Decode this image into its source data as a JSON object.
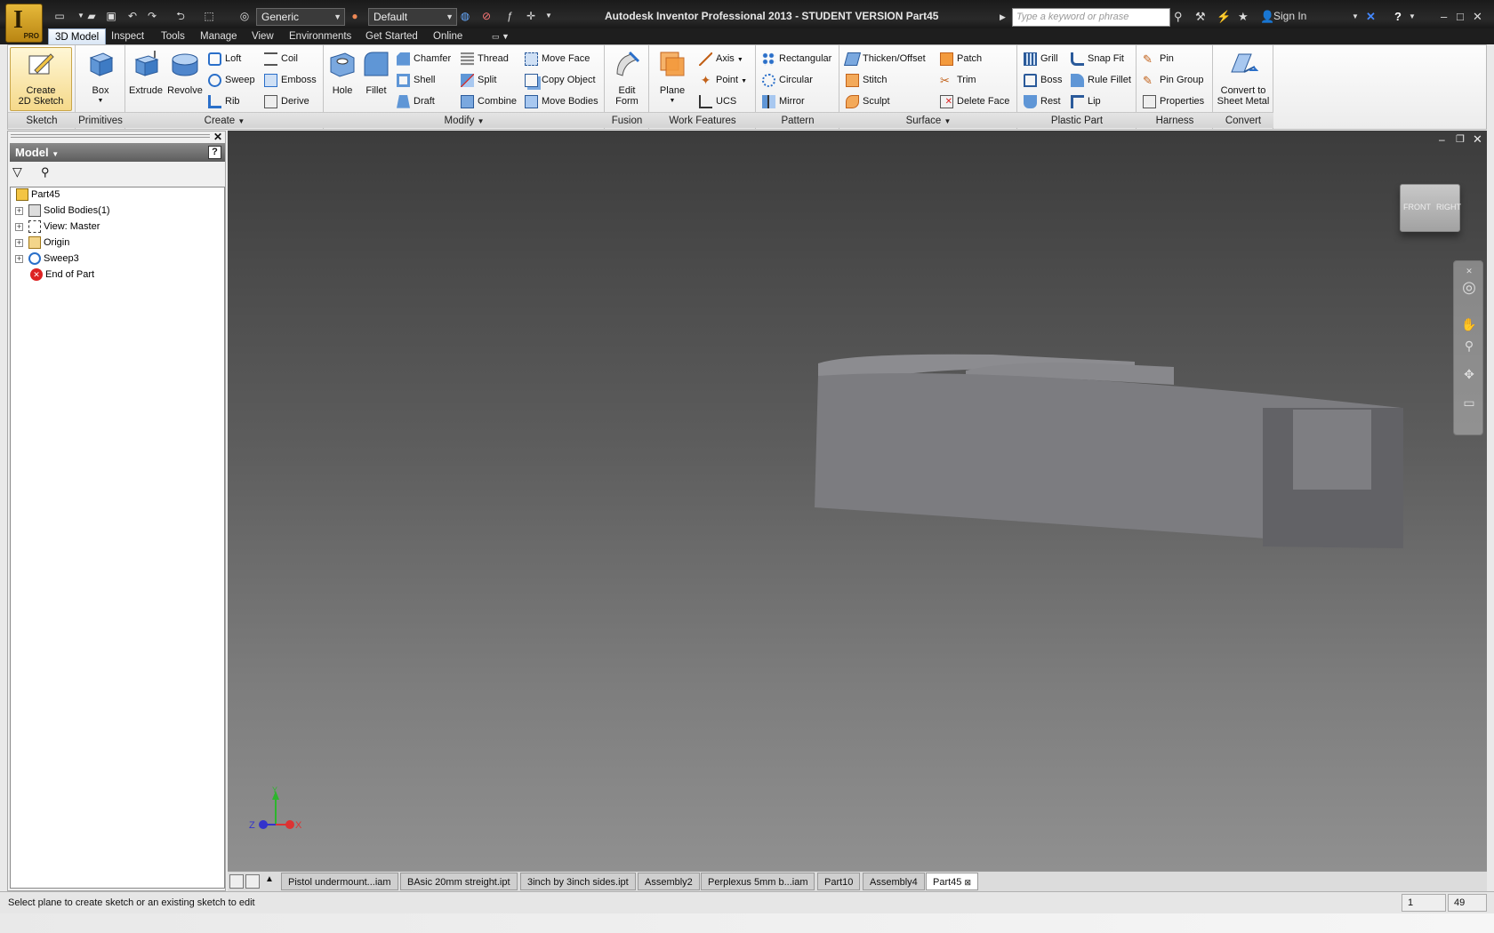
{
  "window": {
    "title": "Autodesk Inventor Professional 2013 - STUDENT VERSION   Part45",
    "logo_letter": "I",
    "logo_badge": "PRO"
  },
  "quick_access": {
    "material": "Generic",
    "appearance": "Default",
    "search_placeholder": "Type a keyword or phrase",
    "sign_in": "Sign In"
  },
  "menu_tabs": [
    "3D Model",
    "Inspect",
    "Tools",
    "Manage",
    "View",
    "Environments",
    "Get Started",
    "Online"
  ],
  "ribbon": {
    "sketch": {
      "title": "Sketch",
      "create_2d_sketch": [
        "Create",
        "2D Sketch"
      ]
    },
    "primitives": {
      "title": "Primitives",
      "box": "Box"
    },
    "create": {
      "title": "Create",
      "extrude": "Extrude",
      "revolve": "Revolve",
      "loft": "Loft",
      "sweep": "Sweep",
      "rib": "Rib",
      "coil": "Coil",
      "emboss": "Emboss",
      "derive": "Derive"
    },
    "modify": {
      "title": "Modify",
      "hole": "Hole",
      "fillet": "Fillet",
      "chamfer": "Chamfer",
      "shell": "Shell",
      "draft": "Draft",
      "thread": "Thread",
      "split": "Split",
      "combine": "Combine",
      "move_face": "Move Face",
      "copy_object": "Copy Object",
      "move_bodies": "Move Bodies"
    },
    "fusion": {
      "title": "Fusion",
      "edit_form": [
        "Edit",
        "Form"
      ]
    },
    "work_features": {
      "title": "Work Features",
      "plane": "Plane",
      "axis": "Axis",
      "point": "Point",
      "ucs": "UCS"
    },
    "pattern": {
      "title": "Pattern",
      "rectangular": "Rectangular",
      "circular": "Circular",
      "mirror": "Mirror"
    },
    "surface": {
      "title": "Surface",
      "thicken_offset": "Thicken/Offset",
      "stitch": "Stitch",
      "sculpt": "Sculpt",
      "patch": "Patch",
      "trim": "Trim",
      "delete_face": "Delete Face"
    },
    "plastic_part": {
      "title": "Plastic Part",
      "grill": "Grill",
      "boss": "Boss",
      "rest": "Rest",
      "snap_fit": "Snap Fit",
      "rule_fillet": "Rule Fillet",
      "lip": "Lip"
    },
    "harness": {
      "title": "Harness",
      "pin": "Pin",
      "pin_group": "Pin Group",
      "properties": "Properties"
    },
    "convert": {
      "title": "Convert",
      "convert_to_sheet_metal": [
        "Convert to",
        "Sheet Metal"
      ]
    }
  },
  "browser": {
    "title": "Model",
    "help": "?",
    "tree": [
      {
        "label": "Part45",
        "root": true
      },
      {
        "label": "Solid Bodies(1)"
      },
      {
        "label": "View: Master"
      },
      {
        "label": "Origin"
      },
      {
        "label": "Sweep3"
      },
      {
        "label": "End of Part"
      }
    ]
  },
  "viewcube": {
    "front": "FRONT",
    "right": "RIGHT"
  },
  "axes": {
    "x": "X",
    "y": "Y",
    "z": "Z"
  },
  "document_tabs": [
    "Pistol undermount...iam",
    "BAsic 20mm streight.ipt",
    "3inch by 3inch sides.ipt",
    "Assembly2",
    "Perplexus 5mm b...iam",
    "Part10",
    "Assembly4",
    "Part45"
  ],
  "active_document": "Part45",
  "status": {
    "message": "Select plane to create sketch or an existing sketch to edit",
    "cell1": "1",
    "cell2": "49"
  },
  "colors": {
    "ribbon_bg": "#eeeeee",
    "viewport_top": "#3c3c3c",
    "viewport_bottom": "#909090",
    "part_face": "#7c7c80",
    "accent_blue": "#2a6fc9"
  }
}
